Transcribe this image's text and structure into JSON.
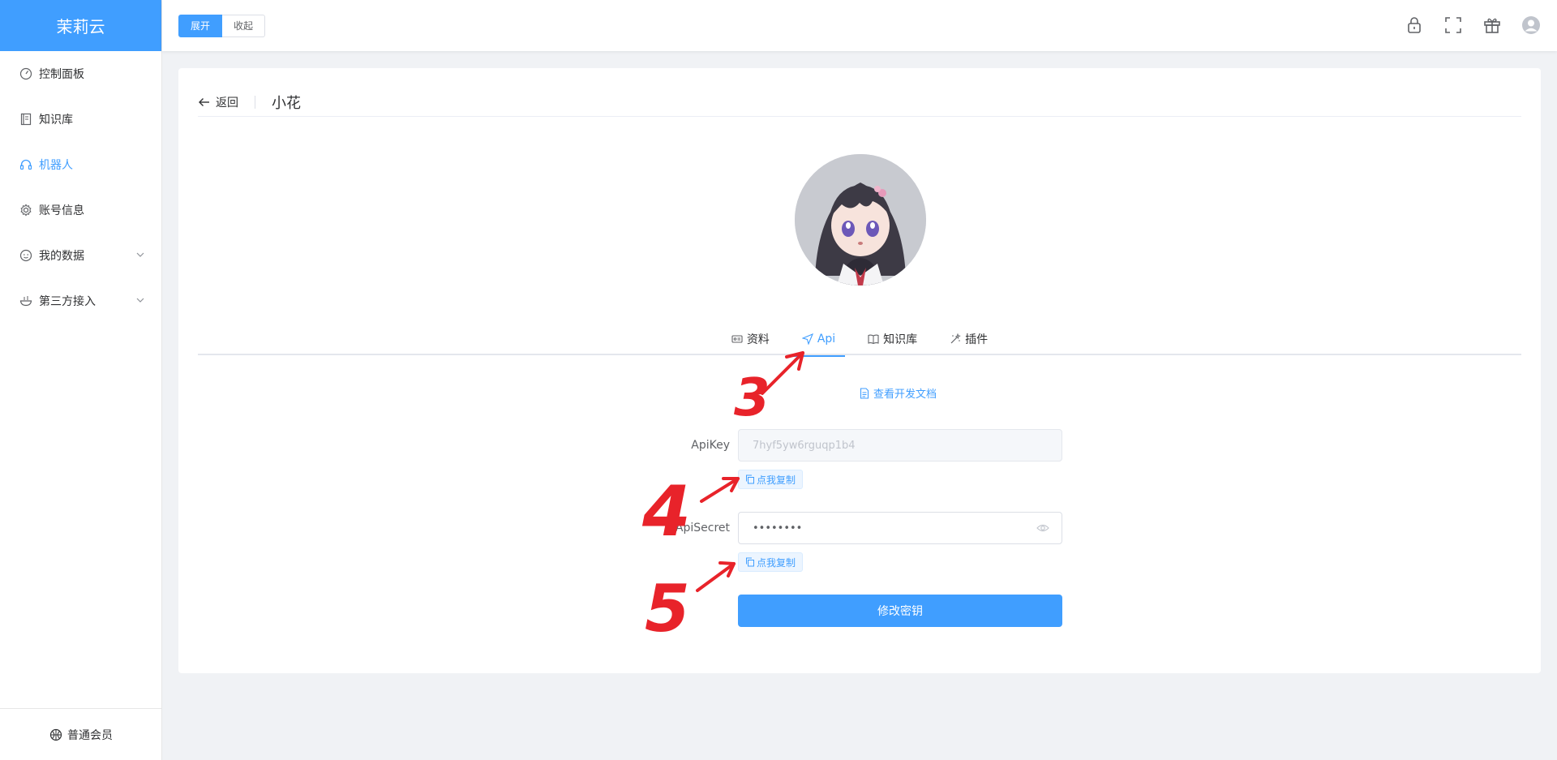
{
  "sidebar": {
    "logo": "茉莉云",
    "items": [
      {
        "label": "控制面板",
        "icon": "dashboard-icon"
      },
      {
        "label": "知识库",
        "icon": "book-icon"
      },
      {
        "label": "机器人",
        "icon": "headset-icon",
        "active": true
      },
      {
        "label": "账号信息",
        "icon": "gear-icon"
      },
      {
        "label": "我的数据",
        "icon": "smile-icon",
        "expandable": true
      },
      {
        "label": "第三方接入",
        "icon": "bowl-icon",
        "expandable": true
      }
    ],
    "member": "普通会员"
  },
  "header": {
    "expand_label": "展开",
    "collapse_label": "收起",
    "icons": [
      "lock-icon",
      "fullscreen-icon",
      "gift-icon",
      "user-avatar-icon"
    ]
  },
  "page": {
    "back_label": "返回",
    "title": "小花",
    "tabs": [
      {
        "label": "资料",
        "icon": "id-card-icon"
      },
      {
        "label": "Api",
        "icon": "send-icon",
        "active": true
      },
      {
        "label": "知识库",
        "icon": "open-book-icon"
      },
      {
        "label": "插件",
        "icon": "magic-icon"
      }
    ],
    "doc_link": "查看开发文档",
    "apikey_label": "ApiKey",
    "apikey_value": "7hyf5yw6rguqp1b4",
    "apisecret_label": "ApiSecret",
    "apisecret_value": "••••••••",
    "copy_label": "点我复制",
    "submit_label": "修改密钥"
  },
  "annotations": [
    "3",
    "4",
    "5"
  ],
  "colors": {
    "primary": "#409eff",
    "annotation": "#e8232a"
  }
}
